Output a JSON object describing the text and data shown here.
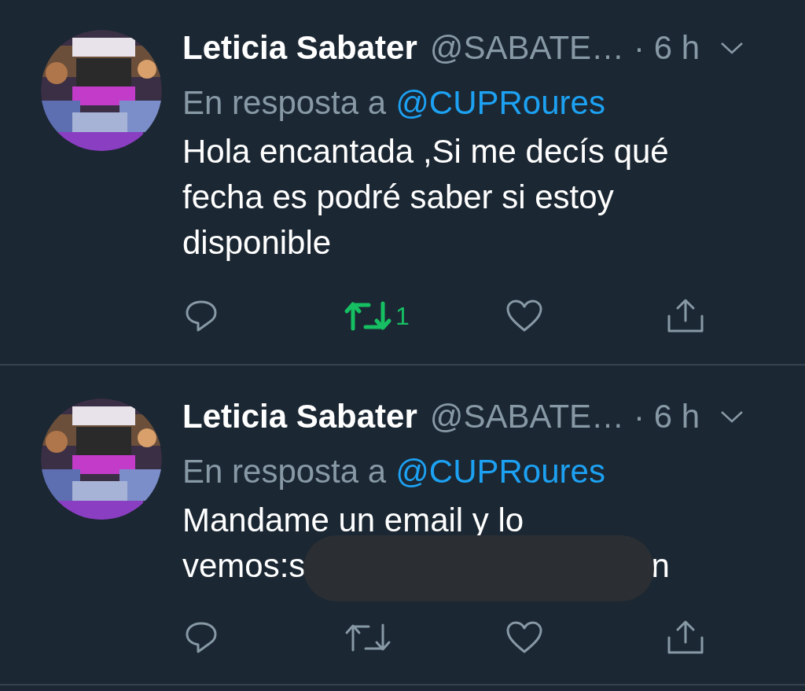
{
  "tweets": [
    {
      "name": "Leticia Sabater",
      "handle": "@SABATE…",
      "time": "· 6 h",
      "reply_prefix": "En resposta a",
      "reply_to": "@CUPRoures",
      "body": "Hola encantada ,Si me decís qué fecha es podré saber si estoy disponible",
      "actions": {
        "retweeted": true,
        "retweet_count": "1",
        "liked": false
      }
    },
    {
      "name": "Leticia Sabater",
      "handle": "@SABATE…",
      "time": "· 6 h",
      "reply_prefix": "En resposta a",
      "reply_to": "@CUPRoures",
      "body": "Mandame un email y lo",
      "redacted": {
        "visible_start": "vemos:s",
        "visible_end": "n"
      },
      "actions": {
        "retweeted": false,
        "liked": false
      }
    }
  ]
}
